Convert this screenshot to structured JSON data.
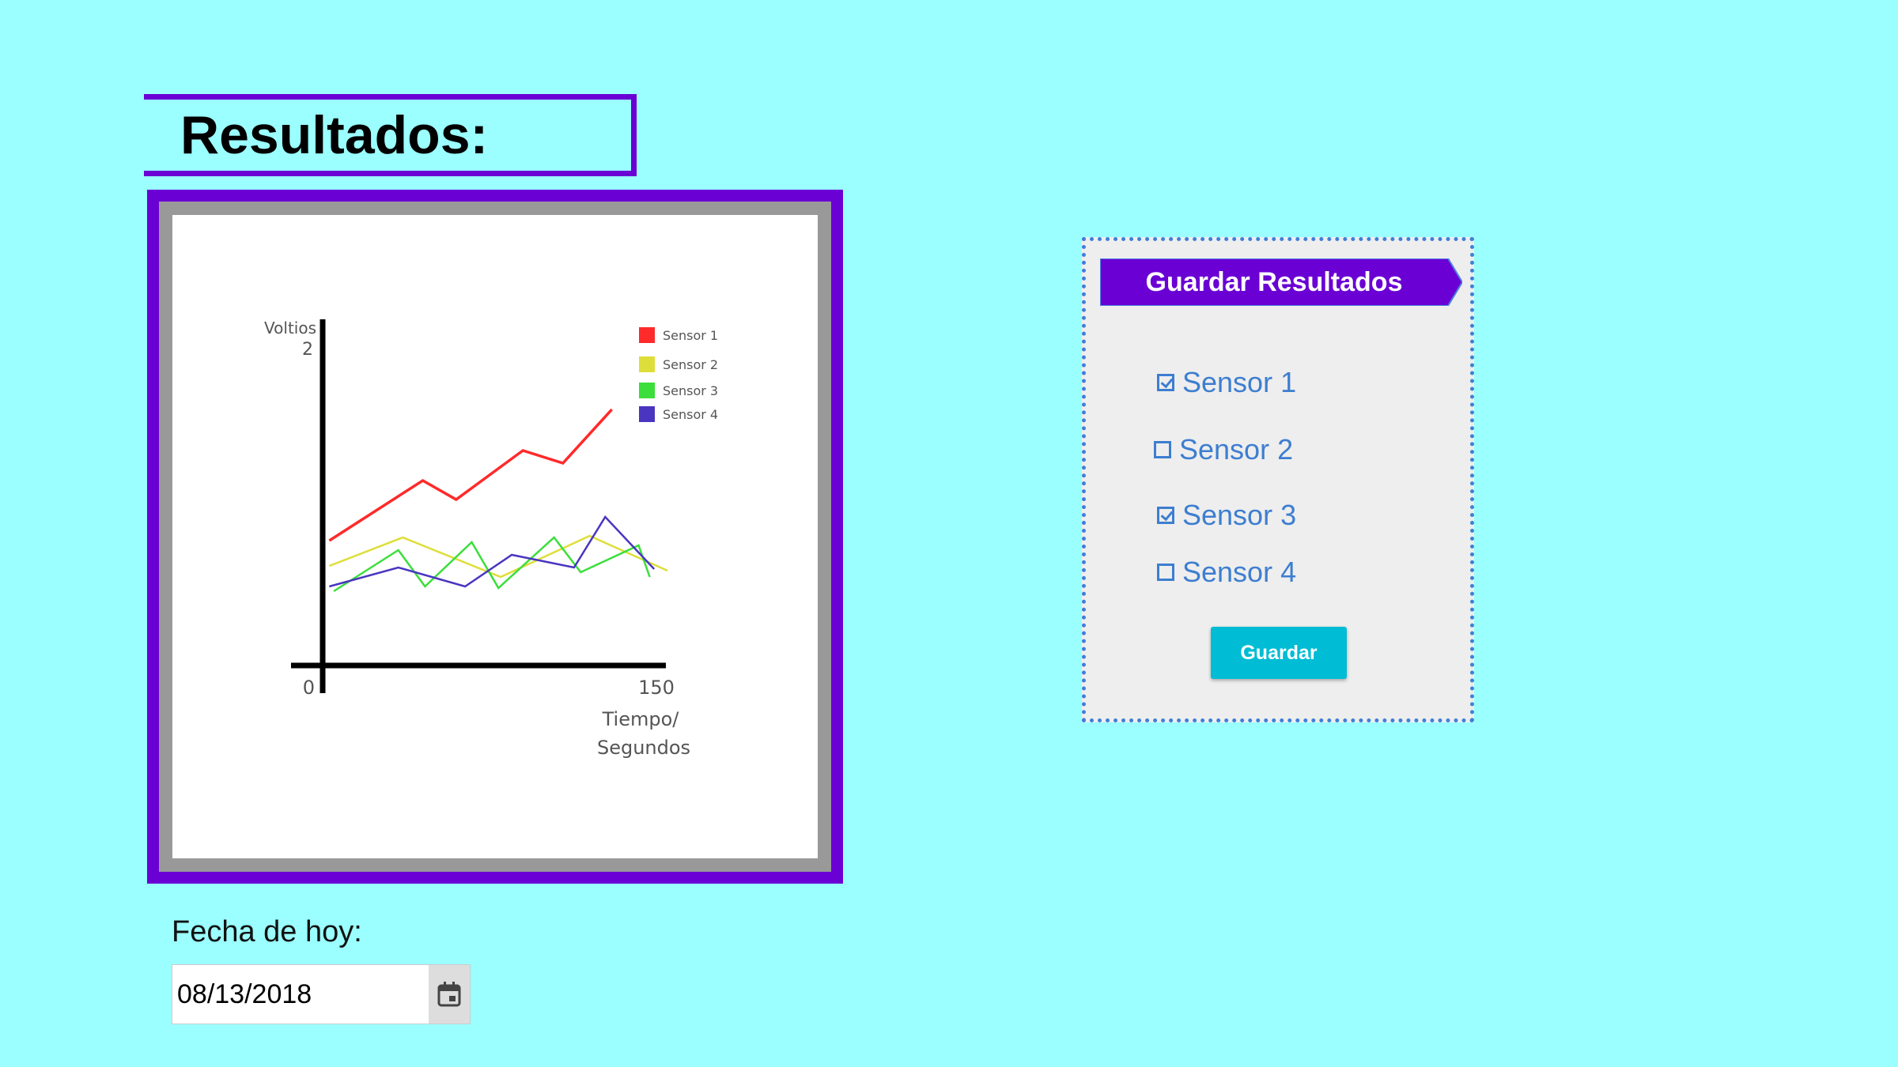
{
  "page": {
    "title": "Resultados:",
    "date_label": "Fecha de hoy:",
    "date_value": "08/13/2018",
    "date_icon": "calendar-icon"
  },
  "panel": {
    "banner": "Guardar Resultados",
    "checkboxes": [
      {
        "label": "Sensor 1",
        "checked": true
      },
      {
        "label": "Sensor 2",
        "checked": false
      },
      {
        "label": "Sensor 3",
        "checked": true
      },
      {
        "label": "Sensor 4",
        "checked": false
      }
    ],
    "save_label": "Guardar",
    "colors": {
      "banner": "#6a00d4",
      "button": "#00bcd4",
      "text": "#3d7ed0"
    }
  },
  "chart_data": {
    "type": "line",
    "ylabel": "Voltios",
    "xlabel": "Tiempo/ Segundos",
    "y_tick_labels": [
      "2"
    ],
    "x_tick_labels": [
      "0",
      "150"
    ],
    "xlim": [
      0,
      150
    ],
    "ylim": [
      0,
      2
    ],
    "legend_position": "top-right",
    "series": [
      {
        "name": "Sensor 1",
        "color": "#ff2a2a",
        "points": [
          [
            3,
            0.79
          ],
          [
            45,
            1.17
          ],
          [
            60,
            1.05
          ],
          [
            90,
            1.36
          ],
          [
            108,
            1.28
          ],
          [
            130,
            1.62
          ]
        ]
      },
      {
        "name": "Sensor 2",
        "color": "#dede3a",
        "points": [
          [
            3,
            0.63
          ],
          [
            36,
            0.81
          ],
          [
            80,
            0.56
          ],
          [
            120,
            0.82
          ],
          [
            155,
            0.6
          ]
        ]
      },
      {
        "name": "Sensor 3",
        "color": "#3bde3b",
        "points": [
          [
            5,
            0.47
          ],
          [
            34,
            0.73
          ],
          [
            46,
            0.5
          ],
          [
            67,
            0.78
          ],
          [
            79,
            0.49
          ],
          [
            104,
            0.81
          ],
          [
            116,
            0.59
          ],
          [
            142,
            0.76
          ],
          [
            147,
            0.56
          ]
        ]
      },
      {
        "name": "Sensor 4",
        "color": "#4a35c0",
        "points": [
          [
            3,
            0.5
          ],
          [
            34,
            0.62
          ],
          [
            64,
            0.5
          ],
          [
            85,
            0.7
          ],
          [
            113,
            0.62
          ],
          [
            127,
            0.94
          ],
          [
            149,
            0.61
          ]
        ]
      }
    ]
  }
}
